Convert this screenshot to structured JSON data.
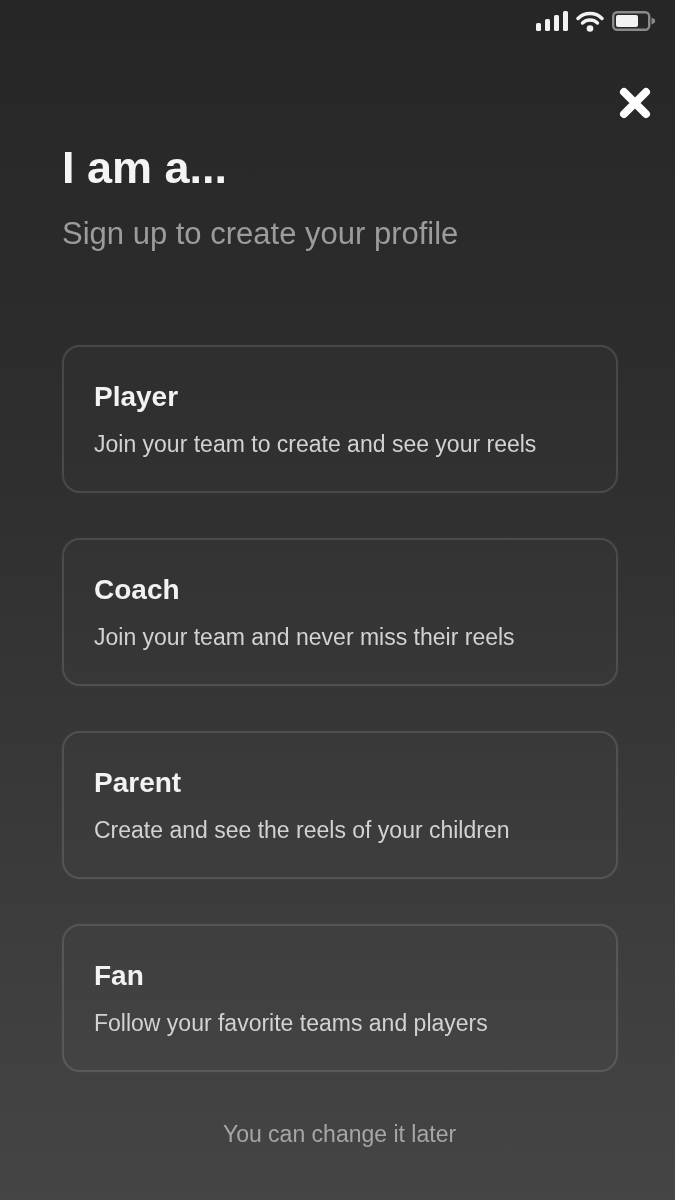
{
  "header": {
    "title": "I am a...",
    "subtitle": "Sign up to create your profile"
  },
  "roles": [
    {
      "title": "Player",
      "description": "Join your team to create and see your reels",
      "selected": false
    },
    {
      "title": "Coach",
      "description": "Join your team and never miss their reels",
      "selected": false
    },
    {
      "title": "Parent",
      "description": "Create and see the reels of your children",
      "selected": false
    },
    {
      "title": "Fan",
      "description": "Follow your favorite teams and players",
      "selected": false
    }
  ],
  "footer_note": "You can change it later"
}
